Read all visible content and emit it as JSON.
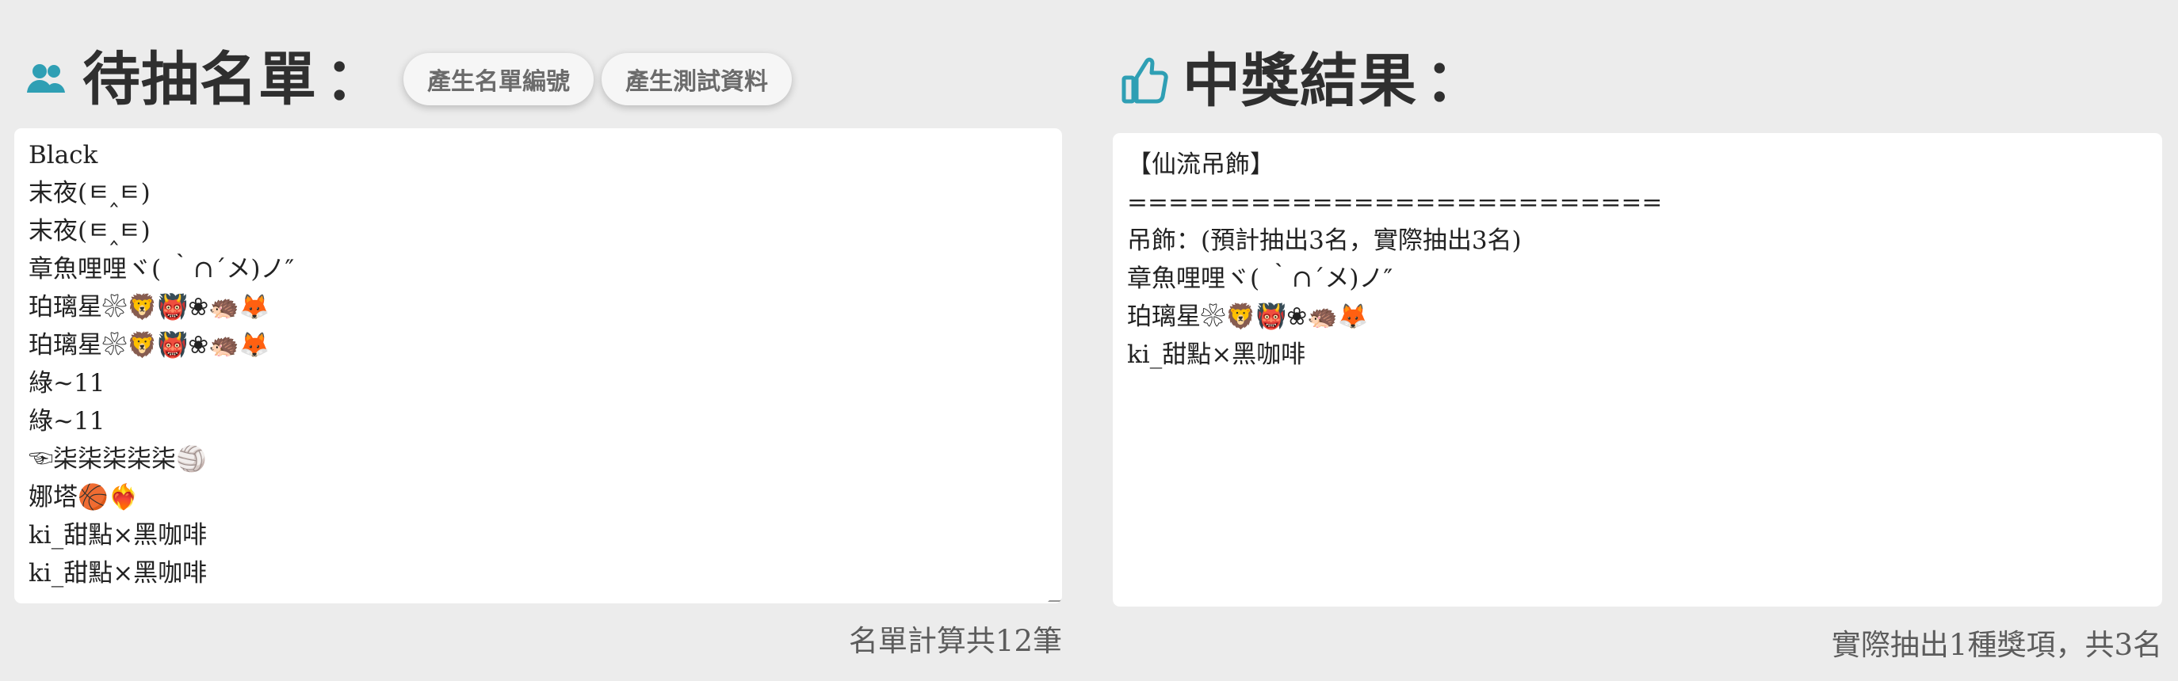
{
  "left": {
    "title": "待抽名單",
    "colon": "：",
    "buttons": [
      "產生名單編號",
      "產生測試資料"
    ],
    "list": [
      "Black",
      "末夜(ㅌ‸ㅌ)",
      "末夜(ㅌ‸ㅌ)",
      "章魚哩哩ヾ( ｀∩´メ)ノ″",
      "珀璃星❀🦁👹❀🦔🦊",
      "珀璃星❀🦁👹❀🦔🦊",
      "綠~11",
      "綠~11",
      "☜柒柒柒柒柒🏐",
      "娜塔🏀❤️‍🔥",
      "ki_甜點×黑咖啡",
      "ki_甜點×黑咖啡"
    ],
    "count_text": "名單計算共12筆"
  },
  "right": {
    "title": "中獎結果",
    "colon": "：",
    "result_lines": [
      "【仙流吊飾】",
      "==========================",
      "吊飾：(預計抽出3名，實際抽出3名)",
      "章魚哩哩ヾ( ｀∩´メ)ノ″",
      "珀璃星❀🦁👹❀🦔🦊",
      "ki_甜點×黑咖啡"
    ],
    "summary_text": "實際抽出1種獎項，共3名"
  },
  "icons": {
    "left": "people-icon",
    "right": "thumbs-up-icon"
  },
  "colors": {
    "accent": "#2f9fb4",
    "background": "#ececec",
    "panel": "#ffffff"
  }
}
